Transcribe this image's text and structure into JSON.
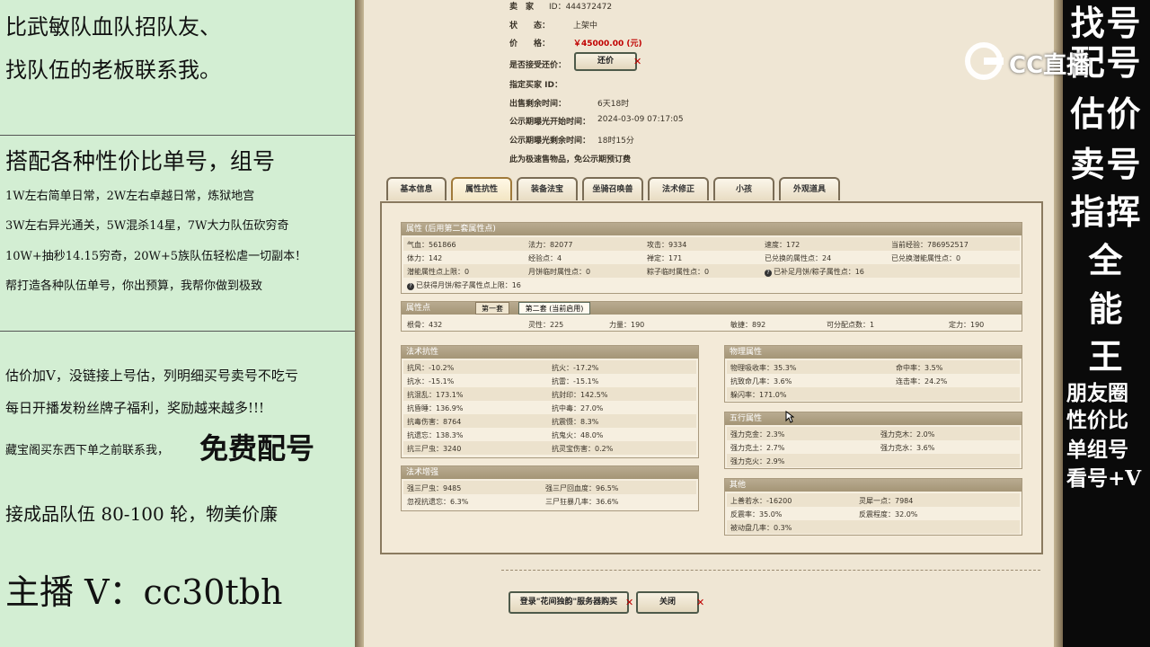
{
  "left_panel": {
    "line1": "比武敏队血队招队友、",
    "line2": "找队伍的老板联系我。",
    "line3": "搭配各种性价比单号，组号",
    "line4": "1W左右简单日常，2W左右卓越日常，炼狱地宫",
    "line5": "3W左右异光通关，5W混杀14星，7W大力队伍砍穷奇",
    "line6": "10W+抽秒14.15穷奇，20W+5族队伍轻松虐一切副本！",
    "line7": "帮打造各种队伍单号，你出预算，我帮你做到极致",
    "line8": "估价加V，没链接上号估，列明细买号卖号不吃亏",
    "line9": "每日开播发粉丝牌子福利，奖励越来越多!!!",
    "line10a": "藏宝阁买东西下单之前联系我，",
    "line10b": "免费配号",
    "line11": "接成品队伍 80-100 轮，物美价廉",
    "line12": "主播 V：cc30tbh"
  },
  "right_panel": {
    "chars": [
      "找号",
      "配号",
      "估价",
      "卖号",
      "指挥",
      "全",
      "能",
      "王"
    ],
    "small_lines": [
      "朋友圈",
      "性价比",
      "单组号",
      "看号+V"
    ]
  },
  "watermark": {
    "text": "CC直播"
  },
  "listing": {
    "seller_label": "卖　家",
    "seller_value": "ID：444372472",
    "status_label": "状　　态：",
    "status_value": "上架中",
    "price_label": "价　　格：",
    "price_value": "￥45000.00 (元)",
    "bargain_label": "是否接受还价：",
    "bargain_button": "还价",
    "buyer_label": "指定买家 ID：",
    "remain_label": "出售剩余时间：",
    "remain_value": "6天18时",
    "pub_start_label": "公示期曝光开始时间：",
    "pub_start_value": "2024-03-09 07:17:05",
    "pub_remain_label": "公示期曝光剩余时间：",
    "pub_remain_value": "18时15分",
    "notice": "此为极速售物品，免公示期预订费"
  },
  "tabs": [
    "基本信息",
    "属性抗性",
    "装备法宝",
    "坐骑召唤兽",
    "法术修正",
    "小孩",
    "外观道具"
  ],
  "attributes": {
    "header": "属性 (后用第二套属性点)",
    "rows": [
      [
        "气血：561866",
        "法力：82077",
        "攻击：9334",
        "速度：172",
        "当前经验：786952517"
      ],
      [
        "体力：142",
        "经验点：4",
        "禅定：171",
        "已兑换的属性点：24",
        "已兑换潜能属性点：0"
      ],
      [
        "潜能属性点上限：0",
        "月饼临时属性点：0",
        "粽子临时属性点：0",
        "已补足月饼/粽子属性点：16"
      ],
      [
        "已获得月饼/粽子属性点上限：16"
      ]
    ]
  },
  "points": {
    "header": "属性点",
    "subtab1": "第一套",
    "subtab2": "第二套 (当前启用)",
    "row": [
      "根骨：432",
      "灵性：225",
      "力量：190",
      "敏捷：892",
      "可分配点数：1",
      "定力：190"
    ]
  },
  "resist": {
    "header": "法术抗性",
    "rows": [
      [
        "抗风：-10.2%",
        "抗火：-17.2%"
      ],
      [
        "抗水：-15.1%",
        "抗雷：-15.1%"
      ],
      [
        "抗混乱：173.1%",
        "抗封印：142.5%"
      ],
      [
        "抗昏睡：136.9%",
        "抗中毒：27.0%"
      ],
      [
        "抗毒伤害：8764",
        "抗震慑：8.3%"
      ],
      [
        "抗遗忘：138.3%",
        "抗鬼火：48.0%"
      ],
      [
        "抗三尸虫：3240",
        "抗灵宝伤害：0.2%"
      ]
    ]
  },
  "enhance": {
    "header": "法术增强",
    "rows": [
      [
        "强三尸虫：9485",
        "强三尸回血度：96.5%"
      ],
      [
        "忽视抗遗忘：6.3%",
        "三尸狂暴几率：36.6%"
      ]
    ]
  },
  "physical": {
    "header": "物理属性",
    "rows": [
      [
        "物理吸收率：35.3%",
        "命中率：3.5%"
      ],
      [
        "抗致命几率：3.6%",
        "连击率：24.2%"
      ],
      [
        "躲闪率：171.0%"
      ]
    ]
  },
  "elements": {
    "header": "五行属性",
    "rows": [
      [
        "强力克金：2.3%",
        "强力克木：2.0%"
      ],
      [
        "强力克土：2.7%",
        "强力克水：3.6%"
      ],
      [
        "强力克火：2.9%"
      ]
    ]
  },
  "others": {
    "header": "其他",
    "rows": [
      [
        "上善若水：-16200",
        "灵犀一点：7984"
      ],
      [
        "反震率：35.0%",
        "反震程度：32.0%"
      ],
      [
        "被动盘几率：0.3%"
      ]
    ]
  },
  "footer": {
    "login_button": "登录\"花间独韵\"服务器购买",
    "close_button": "关闭"
  },
  "colors": {
    "price": "#c00000",
    "right_bg": "#0a0a0a",
    "left_bg": "#d3eed3"
  }
}
